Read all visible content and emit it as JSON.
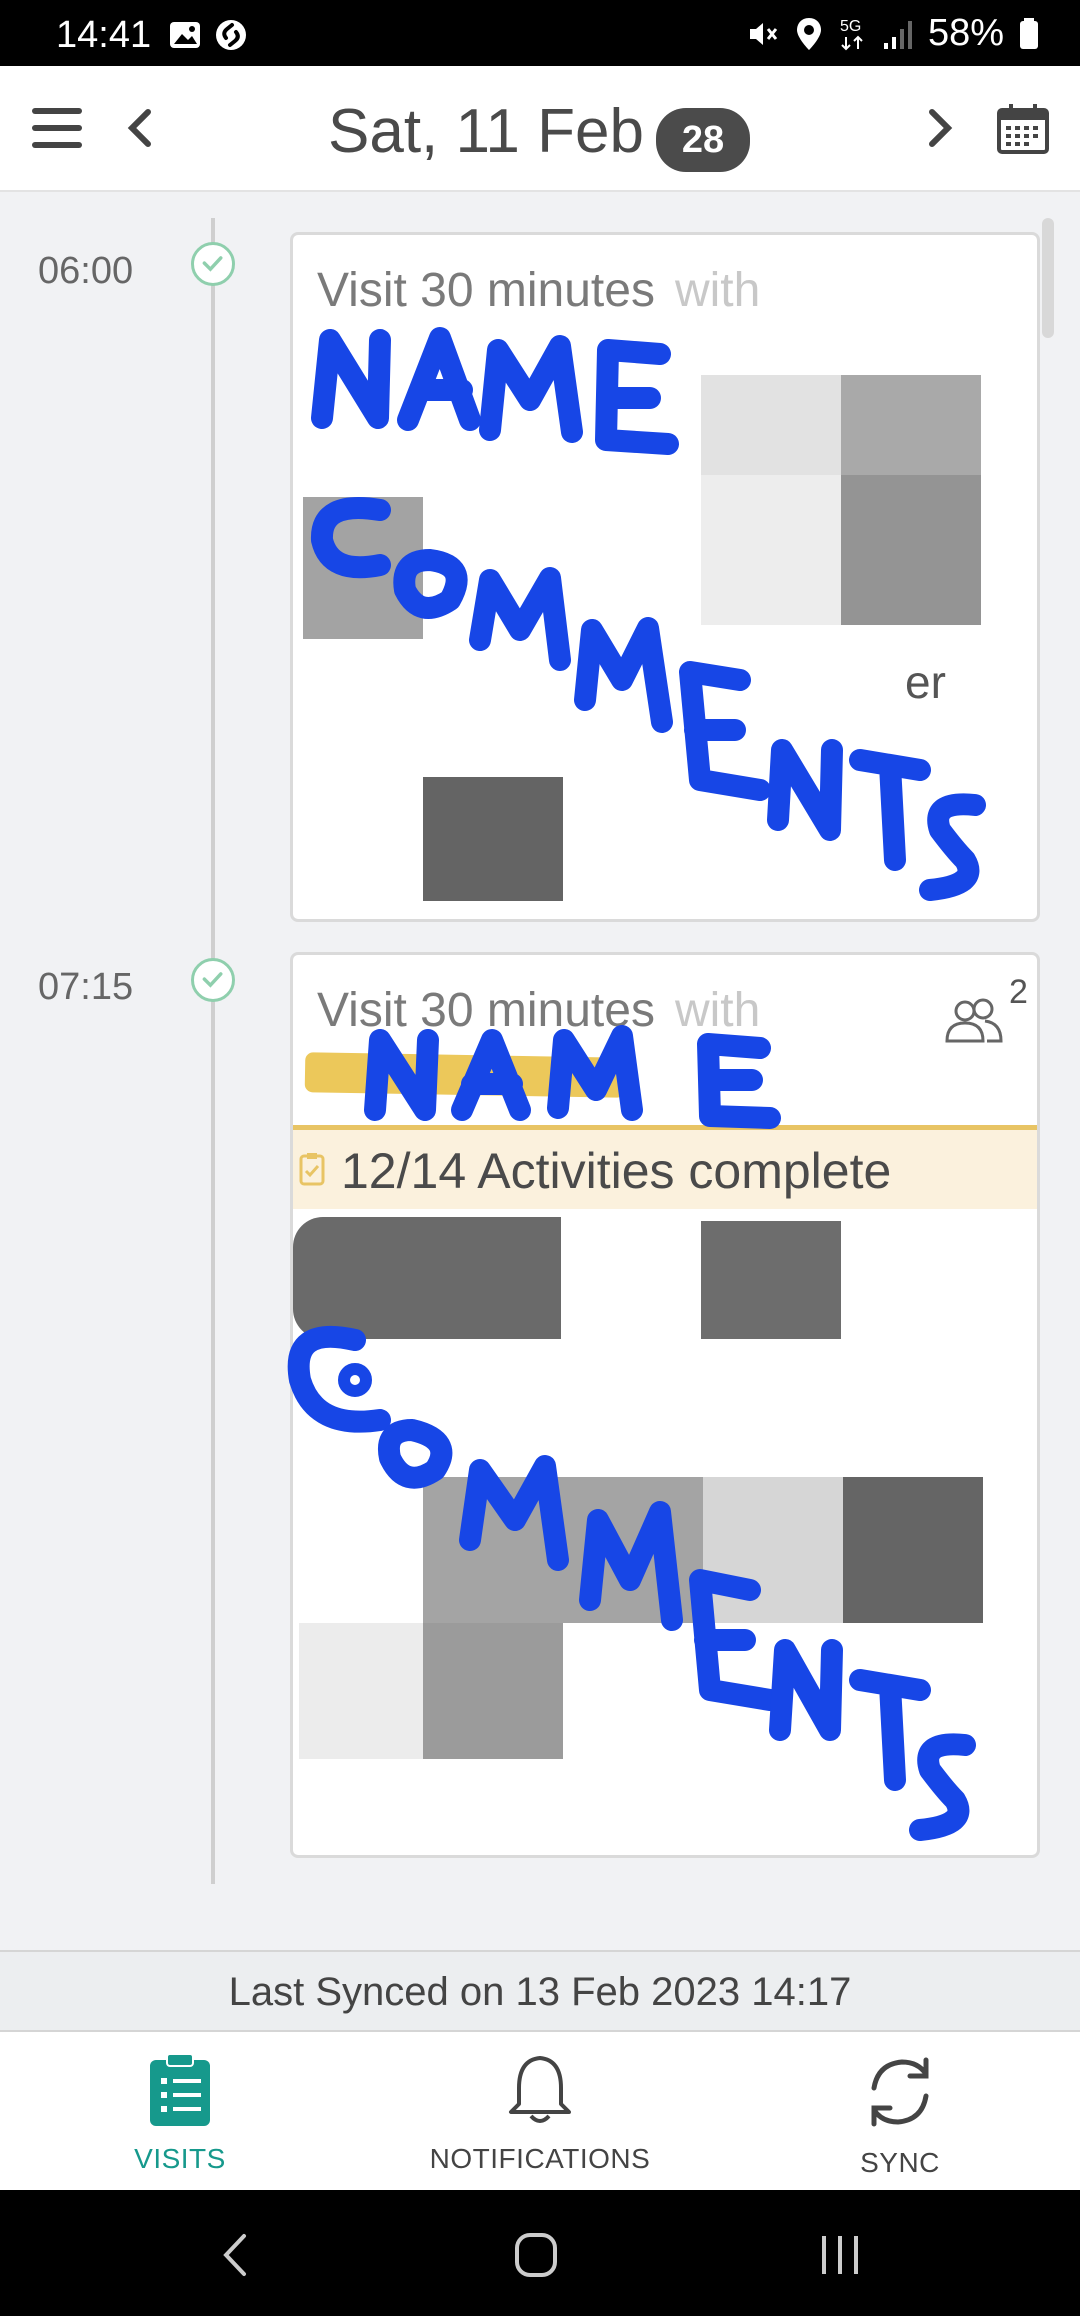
{
  "status_bar": {
    "time": "14:41",
    "battery": "58%",
    "icons": [
      "gallery-icon",
      "shazam-icon",
      "mute-icon",
      "location-icon",
      "5g-icon",
      "signal-icon",
      "battery-icon"
    ]
  },
  "header": {
    "date": "Sat, 11 Feb",
    "badge": "28",
    "icons": [
      "menu-icon",
      "chevron-left-icon",
      "chevron-right-icon",
      "calendar-icon"
    ]
  },
  "visits": [
    {
      "time": "06:00",
      "title": "Visit 30 minutes",
      "with": "with",
      "fragment": "er"
    },
    {
      "time": "07:15",
      "title": "Visit 30 minutes",
      "with": "with",
      "people_count": "2",
      "activities": "12/14 Activities complete"
    }
  ],
  "annotations": {
    "name": "NAME",
    "comments": "COMMENTS"
  },
  "last_synced": "Last Synced on 13 Feb 2023 14:17",
  "bottom_nav": [
    {
      "label": "VISITS",
      "icon": "visits-clipboard-icon",
      "active": true
    },
    {
      "label": "NOTIFICATIONS",
      "icon": "bell-icon",
      "active": false
    },
    {
      "label": "SYNC",
      "icon": "sync-icon",
      "active": false
    }
  ],
  "colors": {
    "accent": "#16998c",
    "activities_bg": "#fbf1dd",
    "activities_border": "#e8c464",
    "scribble": "#1746e6",
    "check": "#8fcfad"
  }
}
